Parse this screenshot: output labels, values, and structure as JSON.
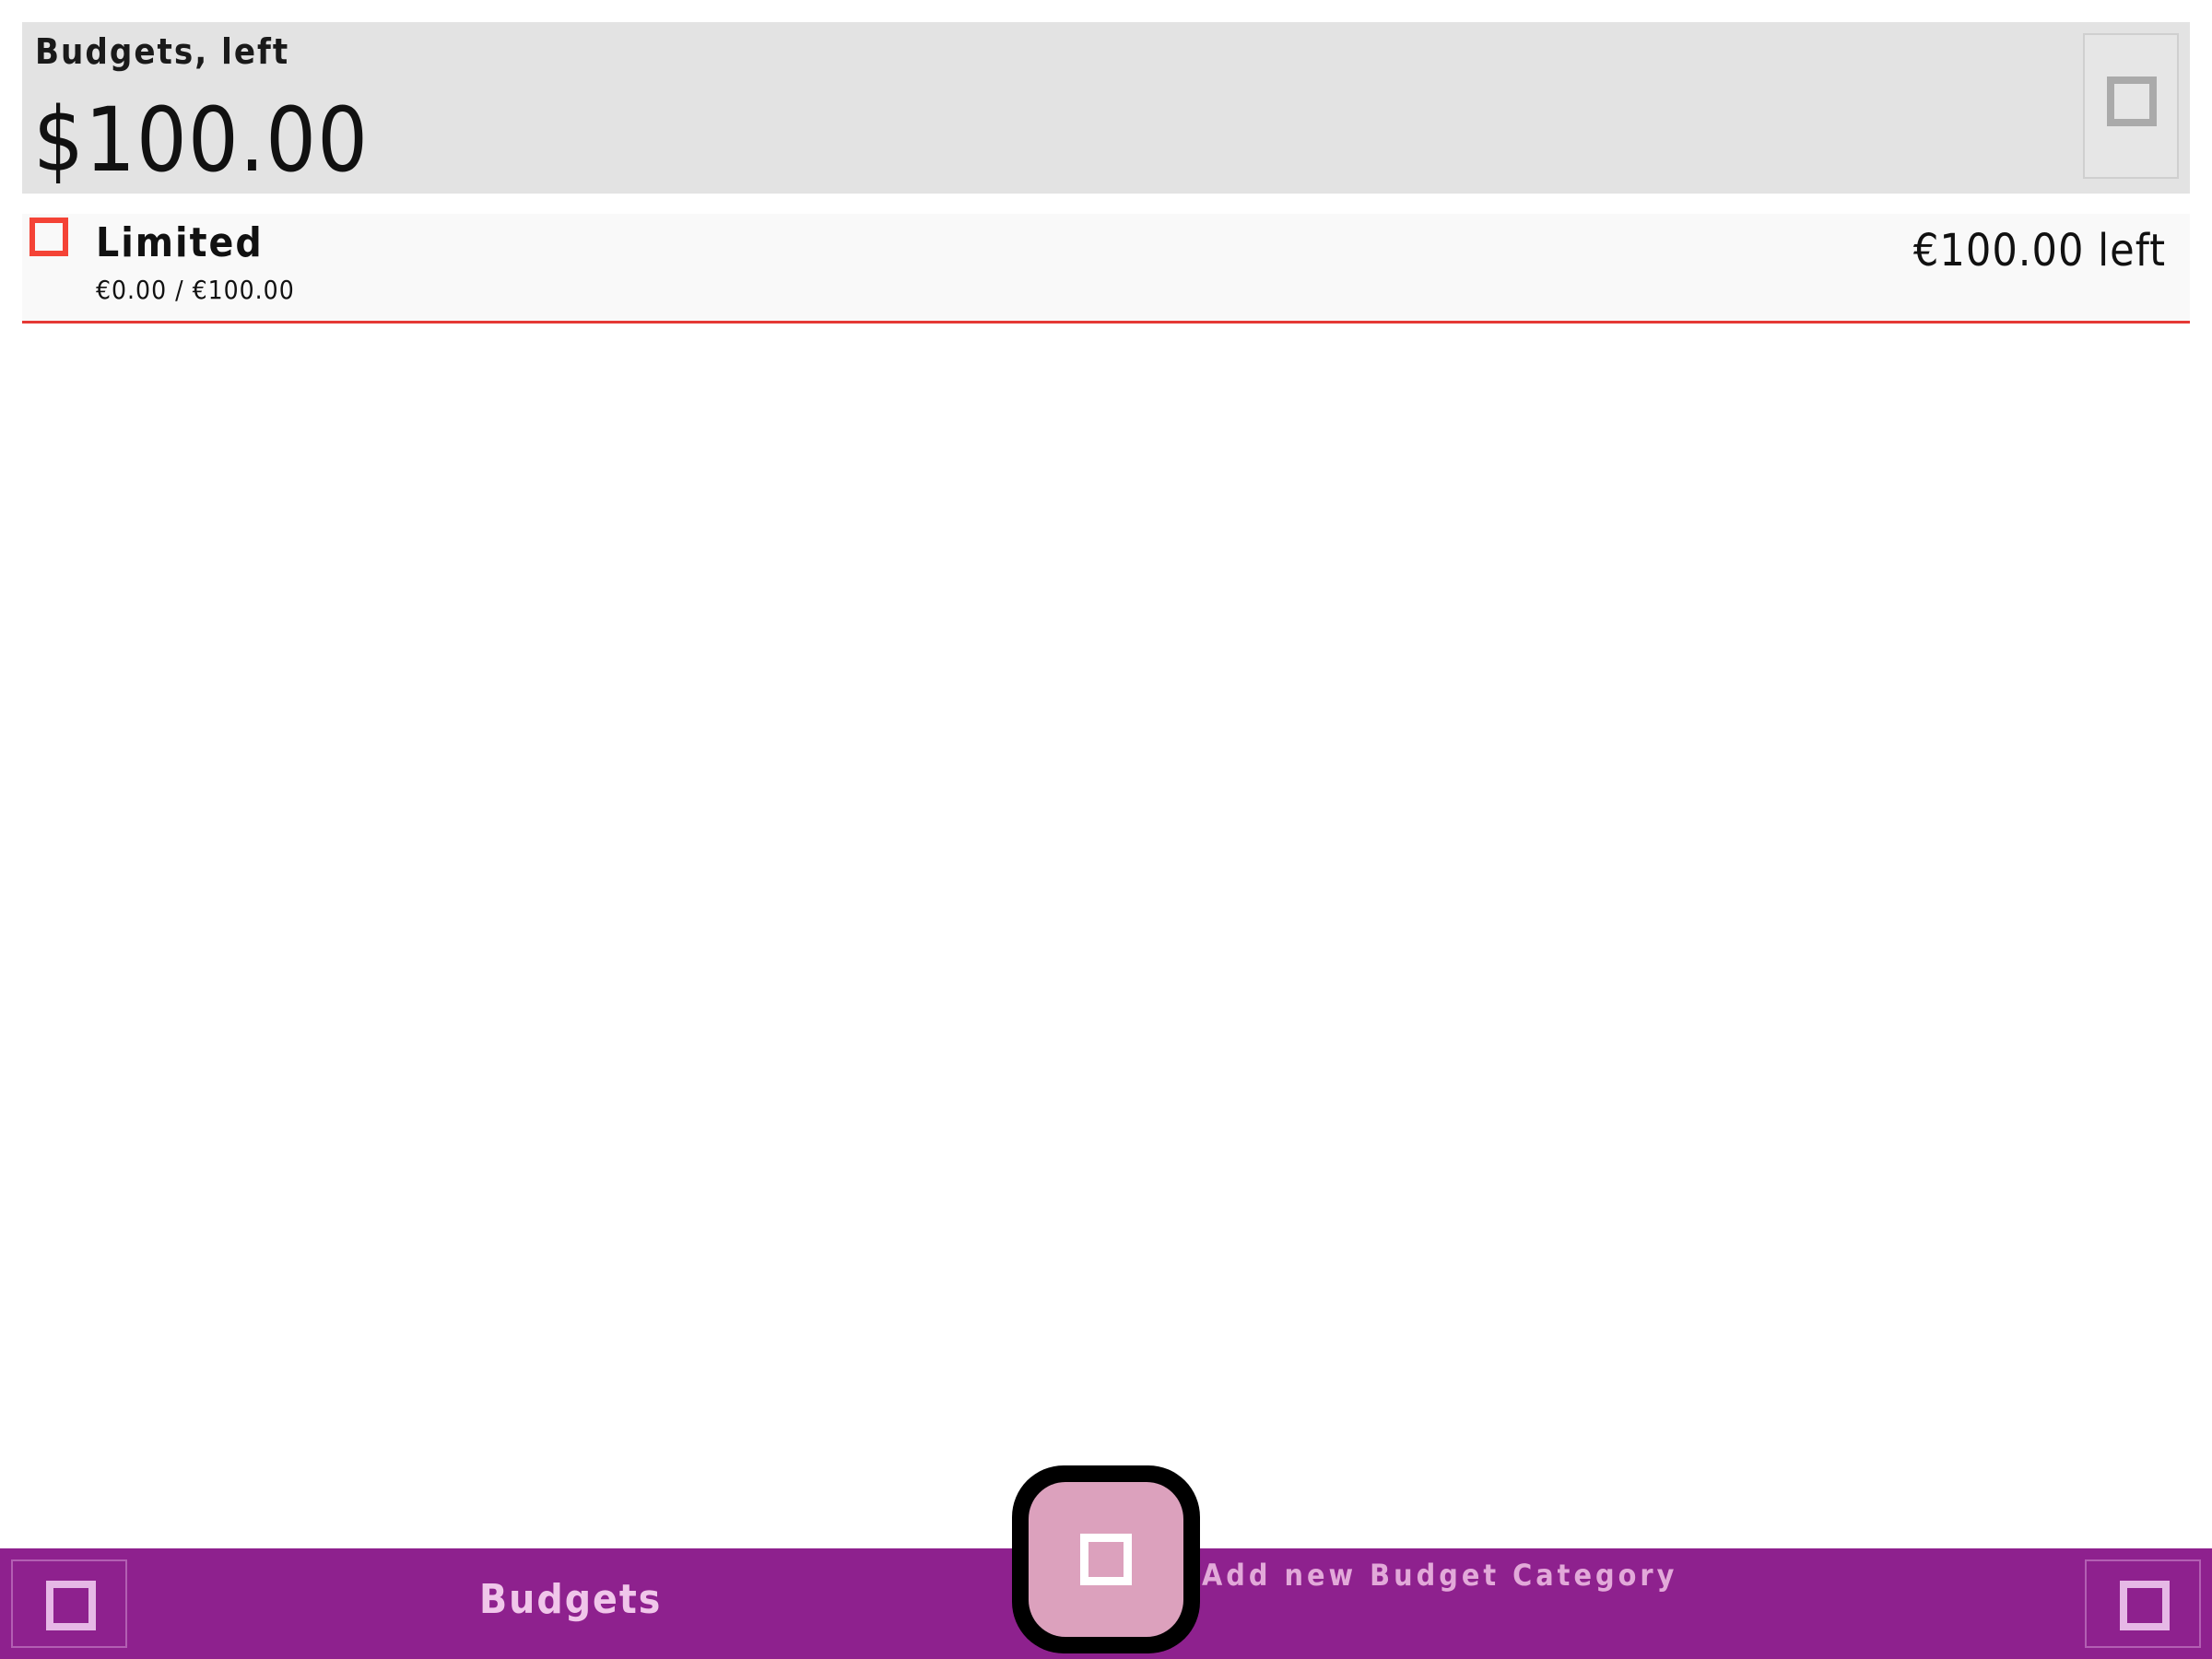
{
  "summary": {
    "label": "Budgets, left",
    "amount": "$100.00",
    "action_icon": "square-icon"
  },
  "budgets": [
    {
      "name": "Limited",
      "progress_text": "€0.00 / €100.00",
      "remaining_text": "€100.00 left",
      "icon": "square-outline-icon",
      "color": "#f44336"
    }
  ],
  "bottom_bar": {
    "title": "Budgets",
    "left_icon": "square-icon",
    "right_icon": "square-icon",
    "background": "#8e218e"
  },
  "fab": {
    "label": "Add new Budget Category",
    "icon": "square-icon",
    "color": "#dca1bd"
  }
}
